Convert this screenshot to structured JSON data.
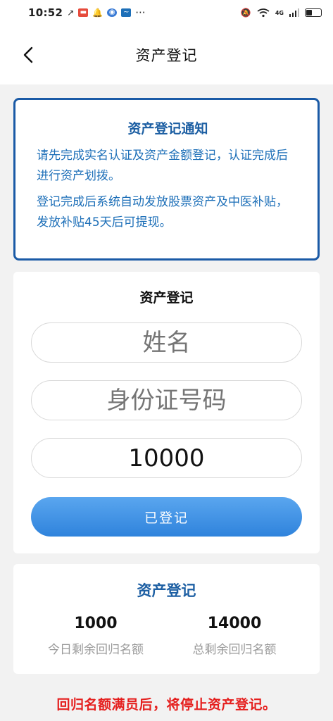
{
  "status_bar": {
    "time": "10:52",
    "more": "···",
    "network": "4G"
  },
  "header": {
    "title": "资产登记"
  },
  "notice": {
    "title": "资产登记通知",
    "paragraph1": "请先完成实名认证及资产金额登记，认证完成后进行资产划拨。",
    "paragraph2": "登记完成后系统自动发放股票资产及中医补贴，发放补贴45天后可提现。",
    "colors": {
      "border": "#1a5aa6",
      "text": "#1d6fb8"
    }
  },
  "form": {
    "title": "资产登记",
    "name_placeholder": "姓名",
    "id_placeholder": "身份证号码",
    "amount_value": "10000",
    "submit_label": "已登记",
    "colors": {
      "button": "#3a8fe4"
    }
  },
  "stats": {
    "title": "资产登记",
    "today_value": "1000",
    "today_label": "今日剩余回归名额",
    "total_value": "14000",
    "total_label": "总剩余回归名额"
  },
  "footer": {
    "warning": "回归名额满员后，将停止资产登记。",
    "color": "#e5201f"
  }
}
